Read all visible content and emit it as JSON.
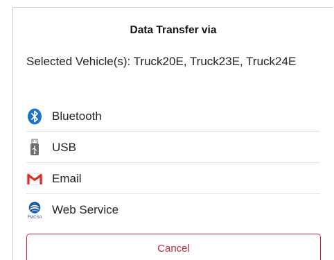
{
  "dialog": {
    "title": "Data Transfer via",
    "selected_vehicles": "Selected Vehicle(s): Truck20E, Truck23E, Truck24E",
    "options": [
      {
        "label": "Bluetooth",
        "icon": "bluetooth-icon"
      },
      {
        "label": "USB",
        "icon": "usb-icon"
      },
      {
        "label": "Email",
        "icon": "gmail-icon"
      },
      {
        "label": "Web Service",
        "icon": "fmcsa-icon",
        "icon_text": "FMCSA"
      }
    ],
    "cancel_label": "Cancel"
  },
  "colors": {
    "cancel_accent": "#c5283d",
    "bluetooth": "#1e73c8",
    "gmail_red": "#d93025",
    "fmcsa_blue": "#1a5aa6"
  }
}
